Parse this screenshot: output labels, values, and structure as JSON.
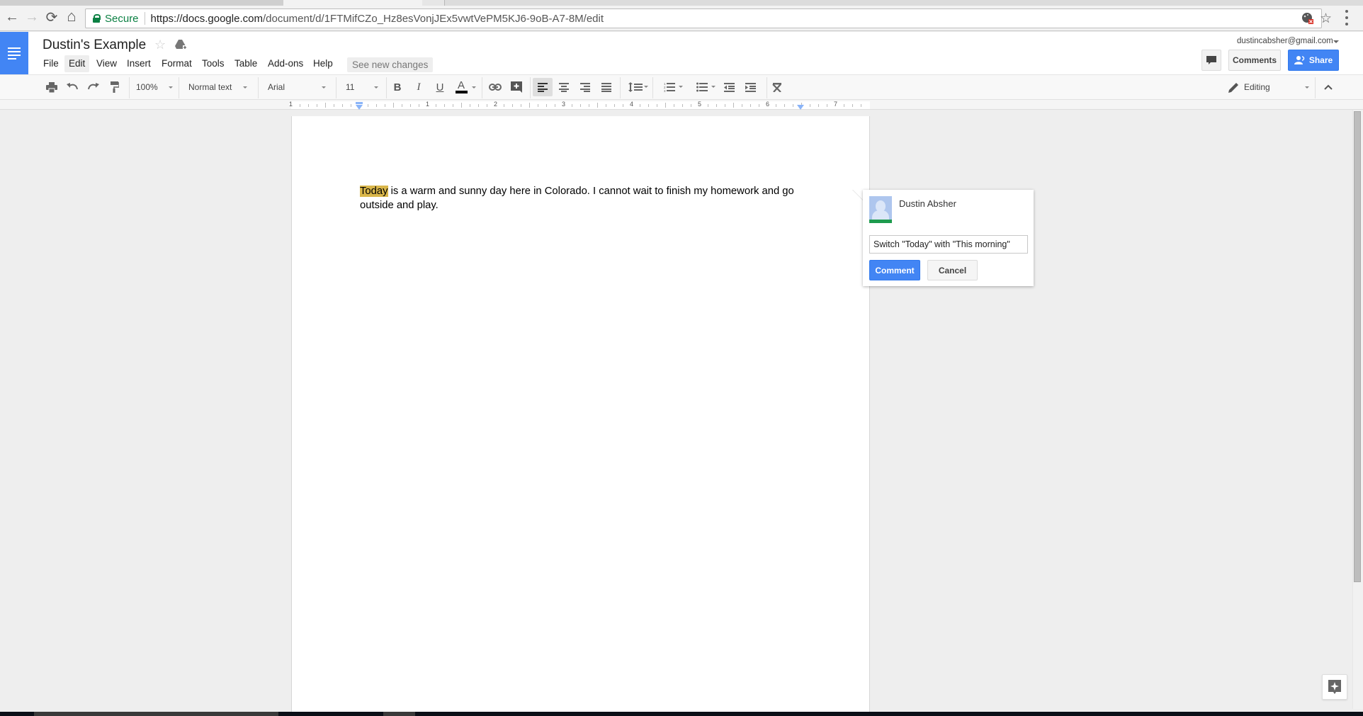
{
  "browser": {
    "back_label": "←",
    "forward_label": "→",
    "reload_label": "⟳",
    "home_label": "⌂",
    "secure_label": "Secure",
    "url_host": "https://docs.google.com",
    "url_path": "/document/d/1FTMifCZo_Hz8esVonjJEx5vwtVePM5KJ6-9oB-A7-8M/edit",
    "bookmark_icon": "☆"
  },
  "header": {
    "doc_title": "Dustin's Example",
    "star_icon": "☆",
    "account_email": "dustincabsher@gmail.com",
    "comments_label": "Comments",
    "share_label": "Share",
    "see_new_changes": "See new changes",
    "menus": [
      "File",
      "Edit",
      "View",
      "Insert",
      "Format",
      "Tools",
      "Table",
      "Add-ons",
      "Help"
    ],
    "active_menu": "Edit"
  },
  "toolbar": {
    "zoom": "100%",
    "style": "Normal text",
    "font": "Arial",
    "font_size": "11",
    "bold": "B",
    "italic": "I",
    "underline": "U",
    "text_color": "A",
    "mode": "Editing",
    "active_alignment": "left",
    "text_color_swatch": "#000000"
  },
  "ruler": {
    "labels": [
      "1",
      "1",
      "2",
      "3",
      "4",
      "5",
      "6",
      "7"
    ]
  },
  "document": {
    "highlighted_word": "Today",
    "body_rest": " is a warm and sunny day here in Colorado.  I cannot wait to finish my homework and go outside and play.",
    "highlight_color": "#d9b64a"
  },
  "comment": {
    "author": "Dustin Absher",
    "input_value": "Switch \"Today\" with \"This morning\"",
    "submit_label": "Comment",
    "cancel_label": "Cancel"
  },
  "colors": {
    "accent": "#4285f4",
    "secure_green": "#0b8043"
  }
}
